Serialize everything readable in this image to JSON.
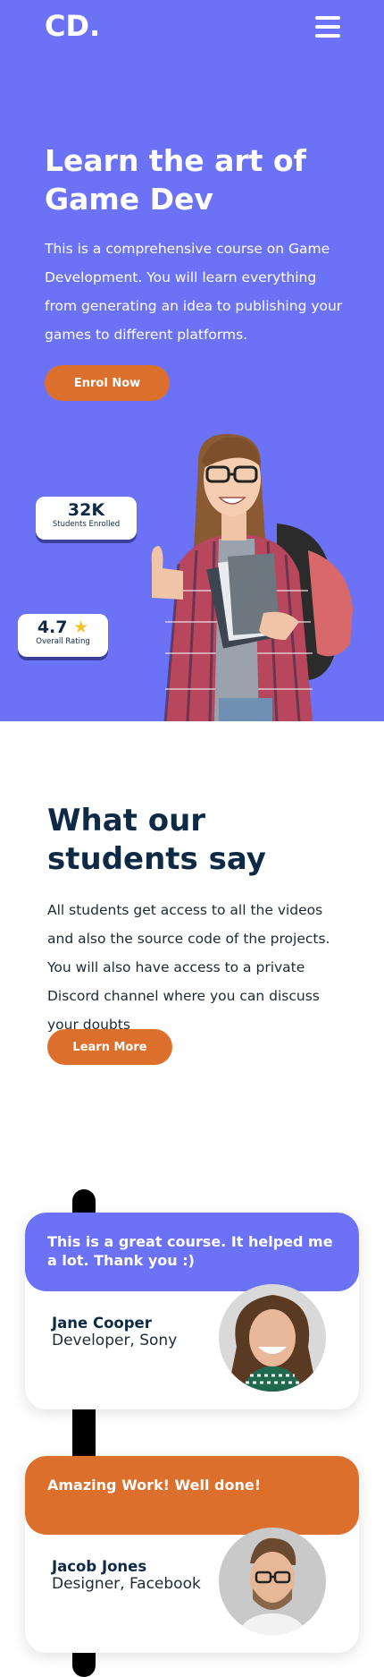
{
  "header": {
    "logo": "CD.",
    "menu_icon": "hamburger-menu-icon"
  },
  "hero": {
    "title": "Learn the art of Game Dev",
    "description": "This is a comprehensive course on Game Development. You will learn everything from generating an idea to publishing your games to different platforms.",
    "cta_label": "Enrol Now",
    "stats": [
      {
        "value": "32K",
        "label": "Students Enrolled"
      },
      {
        "value": "4.7",
        "label": "Overall Rating",
        "icon": "star-icon"
      }
    ]
  },
  "testimonials_intro": {
    "title": "What our students say",
    "description": "All students get access to all the videos and also the source code of the projects. You will also have access to a private Discord channel where you can discuss your doubts",
    "cta_label": "Learn More"
  },
  "testimonials": [
    {
      "quote": "This is a great course. It helped me a lot. Thank you :)",
      "name": "Jane Cooper",
      "role": "Developer, Sony",
      "color": "#6c72f6"
    },
    {
      "quote": "Amazing Work! Well done!",
      "name": "Jacob Jones",
      "role": "Designer, Facebook",
      "color": "#dd6f2c"
    }
  ],
  "colors": {
    "hero_bg": "#6c72f6",
    "accent": "#dd6f2c",
    "heading": "#0e2a44"
  }
}
